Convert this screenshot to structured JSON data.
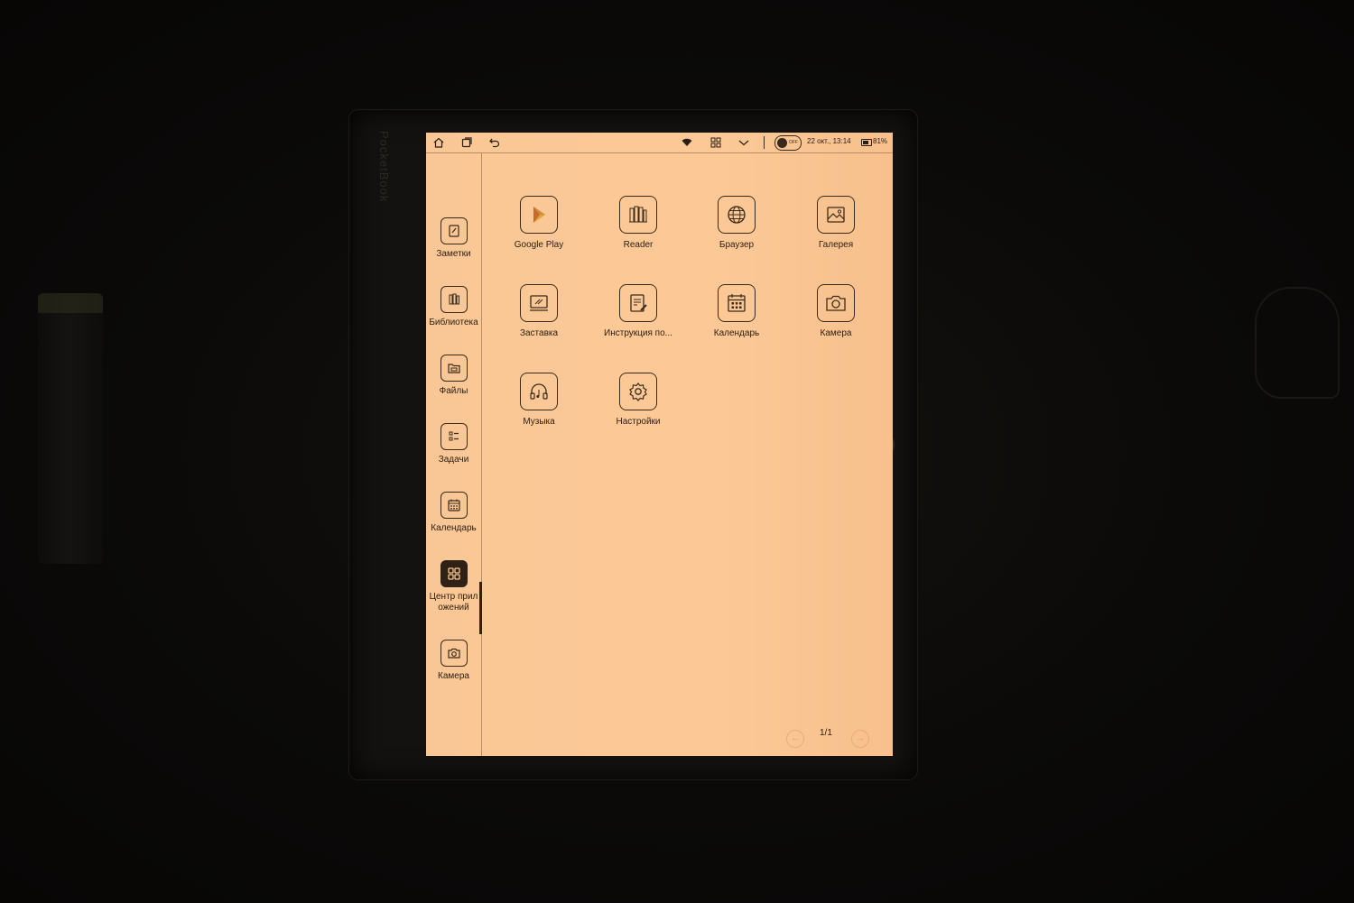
{
  "device": {
    "brand": "PocketBook"
  },
  "statusbar": {
    "lock_label": "OFF",
    "datetime": "22 окт., 13:14",
    "battery": "81%"
  },
  "sidebar": {
    "items": [
      {
        "label": "Заметки",
        "icon": "notes-icon"
      },
      {
        "label": "Библиотека",
        "icon": "library-icon"
      },
      {
        "label": "Файлы",
        "icon": "files-icon"
      },
      {
        "label": "Задачи",
        "icon": "tasks-icon"
      },
      {
        "label": "Календарь",
        "icon": "calendar-icon"
      },
      {
        "label_line1": "Центр прил",
        "label_line2": "ожений",
        "icon": "app-center-icon",
        "active": true
      },
      {
        "label": "Камера",
        "icon": "camera-icon"
      }
    ]
  },
  "apps": [
    {
      "label": "Google Play",
      "icon": "google-play-icon"
    },
    {
      "label": "Reader",
      "icon": "reader-icon"
    },
    {
      "label": "Браузер",
      "icon": "browser-icon"
    },
    {
      "label": "Галерея",
      "icon": "gallery-icon"
    },
    {
      "label": "Заставка",
      "icon": "screensaver-icon"
    },
    {
      "label": "Инструкция по...",
      "icon": "manual-icon"
    },
    {
      "label": "Календарь",
      "icon": "calendar-icon"
    },
    {
      "label": "Камера",
      "icon": "camera-icon"
    },
    {
      "label": "Музыка",
      "icon": "music-icon"
    },
    {
      "label": "Настройки",
      "icon": "settings-icon"
    }
  ],
  "pager": {
    "text": "1/1"
  },
  "colors": {
    "screen": "#fcc996",
    "ink": "#2a1d12",
    "accent": "#2f2116"
  }
}
